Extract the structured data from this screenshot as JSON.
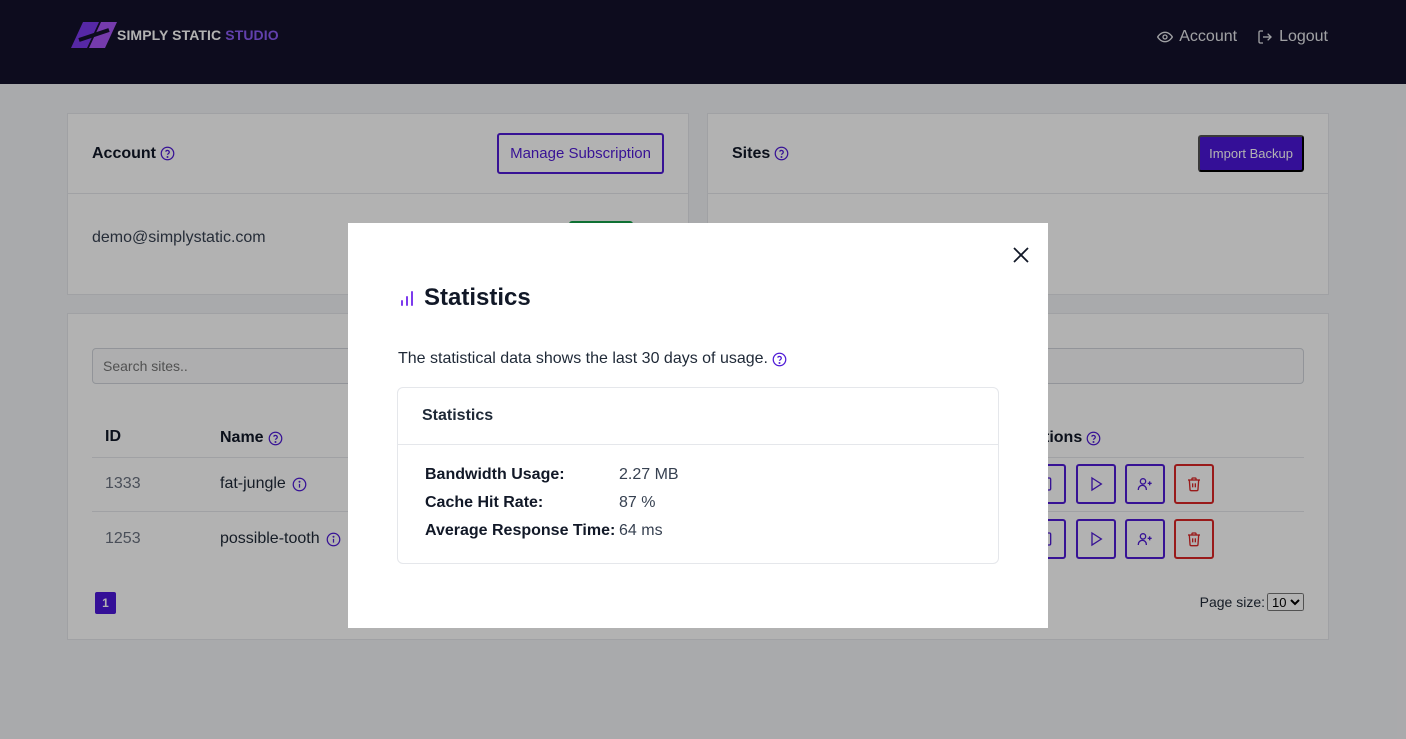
{
  "brand": {
    "name_main": "SIMPLY STATIC",
    "name_accent": "STUDIO"
  },
  "nav": {
    "account": "Account",
    "logout": "Logout"
  },
  "account_card": {
    "title": "Account",
    "manage_button": "Manage Subscription",
    "email": "demo@simplystatic.com"
  },
  "sites_card": {
    "title": "Sites",
    "import_button": "Import Backup"
  },
  "sites_table": {
    "search_placeholder": "Search sites..",
    "columns": {
      "id": "ID",
      "name": "Name",
      "actions": "tions"
    },
    "rows": [
      {
        "id": "1333",
        "name": "fat-jungle"
      },
      {
        "id": "1253",
        "name": "possible-tooth"
      }
    ],
    "current_page": "1",
    "page_size_label": "Page size:",
    "page_size_value": "10"
  },
  "modal": {
    "title": "Statistics",
    "description": "The statistical data shows the last 30 days of usage.",
    "box_title": "Statistics",
    "stats": [
      {
        "label": "Bandwidth Usage:",
        "value": "2.27 MB"
      },
      {
        "label": "Cache Hit Rate:",
        "value": "87 %"
      },
      {
        "label": "Average Response Time:",
        "value": "64 ms"
      }
    ]
  },
  "colors": {
    "accent": "#4b16d8",
    "topbar": "#14122b",
    "danger": "#dc2626",
    "logo_accent": "#8b5cf6"
  }
}
